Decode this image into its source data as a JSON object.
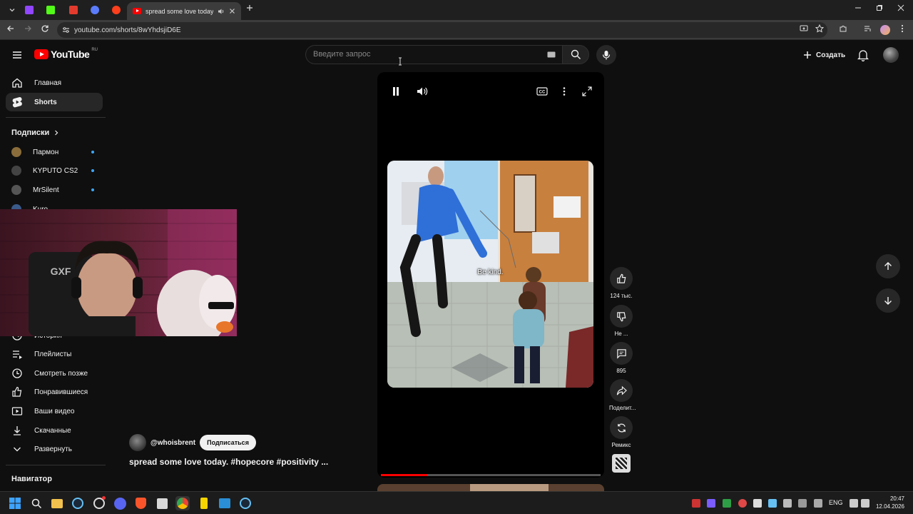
{
  "browser": {
    "active_tab_title": "spread some love today. #h",
    "url": "youtube.com/shorts/8wYhdsjiD6E",
    "window_controls": [
      "minimize",
      "restore",
      "close"
    ]
  },
  "header": {
    "logo_text": "YouTube",
    "region": "RU",
    "search_placeholder": "Введите запрос",
    "create_label": "Создать"
  },
  "sidebar": {
    "items": [
      {
        "label": "Главная",
        "icon": "home-icon"
      },
      {
        "label": "Shorts",
        "icon": "shorts-icon",
        "active": true
      }
    ],
    "subscriptions_heading": "Подписки",
    "subscriptions": [
      {
        "label": "Пармон",
        "color": "#8a6d3b"
      },
      {
        "label": "KYPUTO CS2",
        "color": "#444444"
      },
      {
        "label": "MrSilent",
        "color": "#555555"
      },
      {
        "label": "Kuro",
        "color": "#3a5a8a"
      }
    ],
    "you_items": [
      {
        "label": "История",
        "icon": "history-icon"
      },
      {
        "label": "Плейлисты",
        "icon": "playlists-icon"
      },
      {
        "label": "Смотреть позже",
        "icon": "watch-later-icon"
      },
      {
        "label": "Понравившиеся",
        "icon": "thumb-up-icon"
      },
      {
        "label": "Ваши видео",
        "icon": "your-videos-icon"
      },
      {
        "label": "Скачанные",
        "icon": "download-icon"
      },
      {
        "label": "Развернуть",
        "icon": "chevron-down-icon"
      }
    ],
    "navigator_heading": "Навигатор"
  },
  "short": {
    "caption": "Be kind.",
    "progress": 0.21,
    "channel": "@whoisbrent",
    "subscribe_label": "Подписаться",
    "title": "spread some love today. #hopecore #positivity ..."
  },
  "actions": [
    {
      "icon": "thumb-up-icon",
      "label": "124 тыс."
    },
    {
      "icon": "thumb-down-icon",
      "label": "Не ..."
    },
    {
      "icon": "comment-icon",
      "label": "895"
    },
    {
      "icon": "share-icon",
      "label": "Поделит..."
    },
    {
      "icon": "remix-icon",
      "label": "Ремикс"
    }
  ],
  "webcam": {
    "chair_text": "GXF"
  },
  "taskbar": {
    "lang": "ENG",
    "time": "20:47",
    "date": "12.04.2026"
  },
  "colors": {
    "accent_red": "#ff0000",
    "link_blue": "#3ea6ff",
    "background": "#0f0f0f"
  }
}
